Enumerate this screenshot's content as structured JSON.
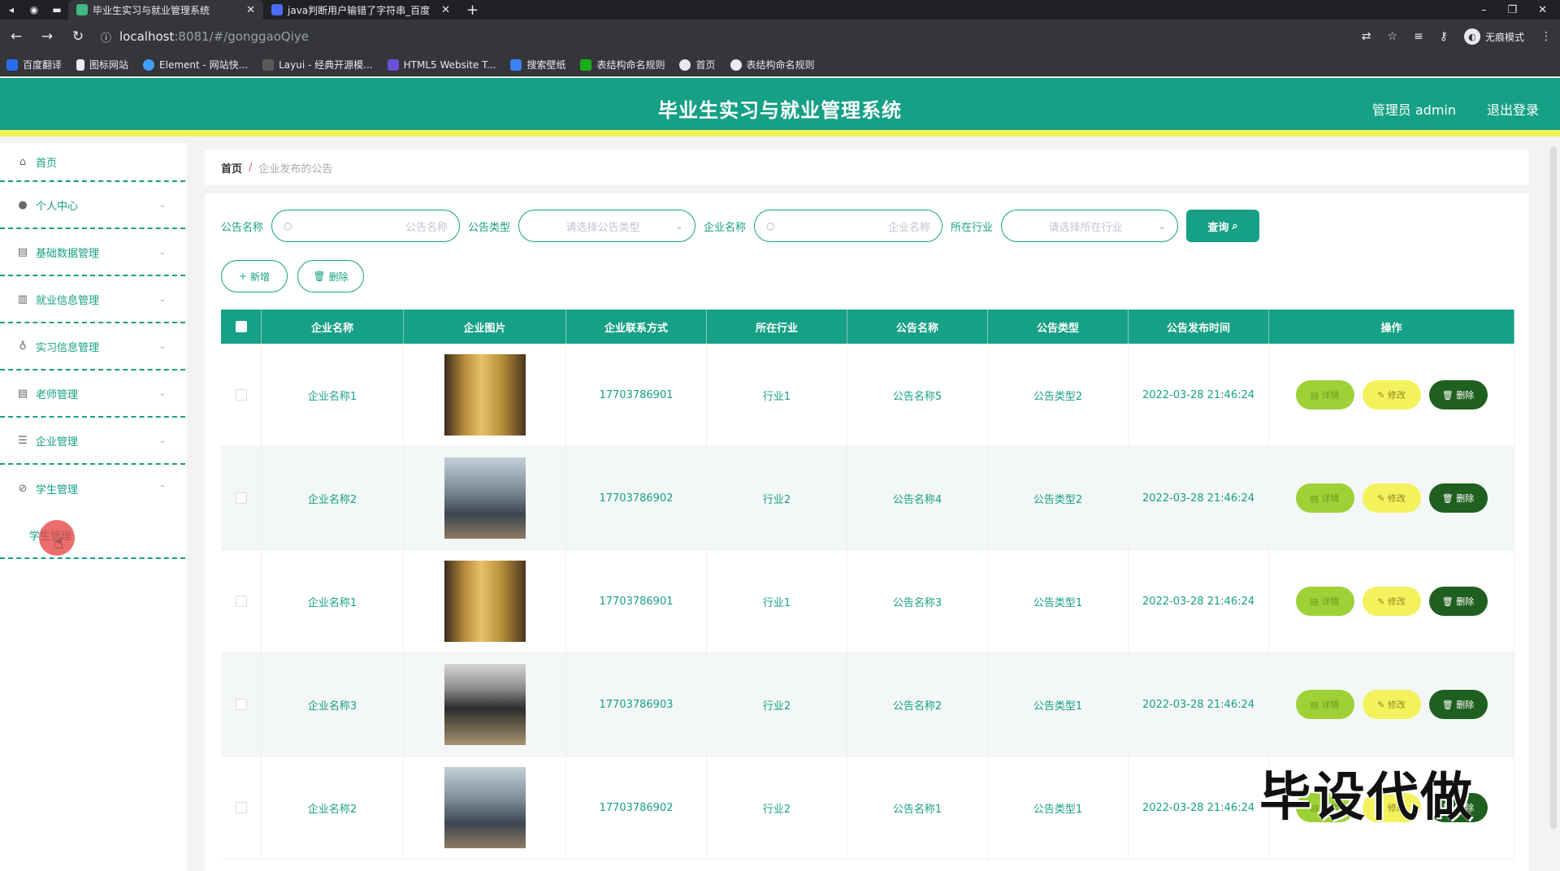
{
  "browser": {
    "tabs": [
      {
        "title": "毕业生实习与就业管理系统",
        "active": true
      },
      {
        "title": "java判断用户输错了字符串_百度",
        "active": false
      }
    ],
    "url_host": "localhost",
    "url_path": ":8081/#/gonggaoQiye",
    "incognito_label": "无痕模式",
    "bookmarks": [
      "百度翻译",
      "图标网站",
      "Element - 网站快...",
      "Layui - 经典开源模...",
      "HTML5 Website T...",
      "搜索壁纸",
      "表结构命名规则",
      "首页",
      "表结构命名规则"
    ]
  },
  "header": {
    "title": "毕业生实习与就业管理系统",
    "user": "管理员 admin",
    "logout": "退出登录"
  },
  "sidebar": {
    "items": [
      {
        "label": "首页",
        "icon": "home-icon"
      },
      {
        "label": "个人中心",
        "icon": "user-icon"
      },
      {
        "label": "基础数据管理",
        "icon": "clipboard-icon"
      },
      {
        "label": "就业信息管理",
        "icon": "bar-chart-icon"
      },
      {
        "label": "实习信息管理",
        "icon": "mic-icon"
      },
      {
        "label": "老师管理",
        "icon": "clipboard-icon"
      },
      {
        "label": "企业管理",
        "icon": "menu-icon"
      },
      {
        "label": "学生管理",
        "icon": "compass-icon"
      }
    ],
    "sub_item": "学生管理"
  },
  "breadcrumb": {
    "home": "首页",
    "sep": "/",
    "current": "企业发布的公告"
  },
  "search": {
    "label_name": "公告名称",
    "placeholder_name": "公告名称",
    "label_type": "公告类型",
    "placeholder_type": "请选择公告类型",
    "label_company": "企业名称",
    "placeholder_company": "企业名称",
    "label_industry": "所在行业",
    "placeholder_industry": "请选择所在行业",
    "query_button": "查询"
  },
  "actions": {
    "add": "新增",
    "delete": "删除"
  },
  "table": {
    "headers": [
      "企业名称",
      "企业图片",
      "企业联系方式",
      "所在行业",
      "公告名称",
      "公告类型",
      "公告发布时间",
      "操作"
    ],
    "rows": [
      {
        "company": "企业名称1",
        "phone": "17703786901",
        "industry": "行业1",
        "notice": "公告名称5",
        "type": "公告类型2",
        "time": "2022-03-28 21:46:24"
      },
      {
        "company": "企业名称2",
        "phone": "17703786902",
        "industry": "行业2",
        "notice": "公告名称4",
        "type": "公告类型2",
        "time": "2022-03-28 21:46:24"
      },
      {
        "company": "企业名称1",
        "phone": "17703786901",
        "industry": "行业1",
        "notice": "公告名称3",
        "type": "公告类型1",
        "time": "2022-03-28 21:46:24"
      },
      {
        "company": "企业名称3",
        "phone": "17703786903",
        "industry": "行业2",
        "notice": "公告名称2",
        "type": "公告类型1",
        "time": "2022-03-28 21:46:24"
      },
      {
        "company": "企业名称2",
        "phone": "17703786902",
        "industry": "行业2",
        "notice": "公告名称1",
        "type": "公告类型1",
        "time": "2022-03-28 21:46:24"
      }
    ],
    "btn_detail": "详情",
    "btn_edit": "修改",
    "btn_delete": "删除"
  },
  "watermark": "毕设代做",
  "colors": {
    "primary": "#16a085",
    "accent_yellow": "#f2f05a",
    "detail_btn": "#9ed136",
    "delete_btn": "#1f5f1f"
  }
}
